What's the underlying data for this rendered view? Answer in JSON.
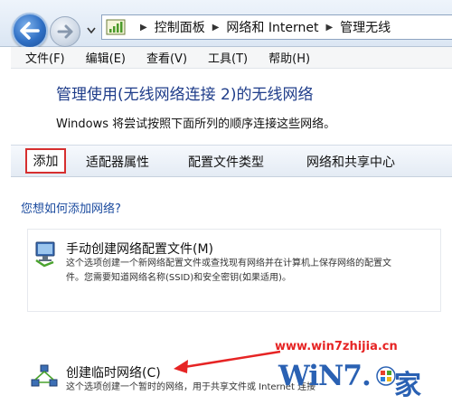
{
  "breadcrumb": {
    "items": [
      "控制面板",
      "网络和 Internet",
      "管理无线"
    ]
  },
  "menu": {
    "items": [
      "文件(F)",
      "编辑(E)",
      "查看(V)",
      "工具(T)",
      "帮助(H)"
    ]
  },
  "header": {
    "title": "管理使用(无线网络连接 2)的无线网络",
    "subtitle": "Windows 将尝试按照下面所列的顺序连接这些网络。"
  },
  "commands": {
    "add": "添加",
    "adapter": "适配器属性",
    "profile_type": "配置文件类型",
    "sharing_center": "网络和共享中心"
  },
  "content": {
    "question": "您想如何添加网络?",
    "manual_option": {
      "title": "手动创建网络配置文件(M)",
      "desc_line1": "这个选项创建一个新网络配置文件或查找现有网络并在计算机上保存网络的配置文",
      "desc_line2": "件。您需要知道网络名称(SSID)和安全密钥(如果适用)。"
    },
    "adhoc_option": {
      "title": "创建临时网络(C)",
      "desc": "这个选项创建一个暂时的网络，用于共享文件或 Internet 连接"
    }
  },
  "annotation": {
    "url": "www.win7zhijia.cn",
    "watermark": "WiN7.",
    "watermark_home": "家",
    "color": "#e62424"
  }
}
